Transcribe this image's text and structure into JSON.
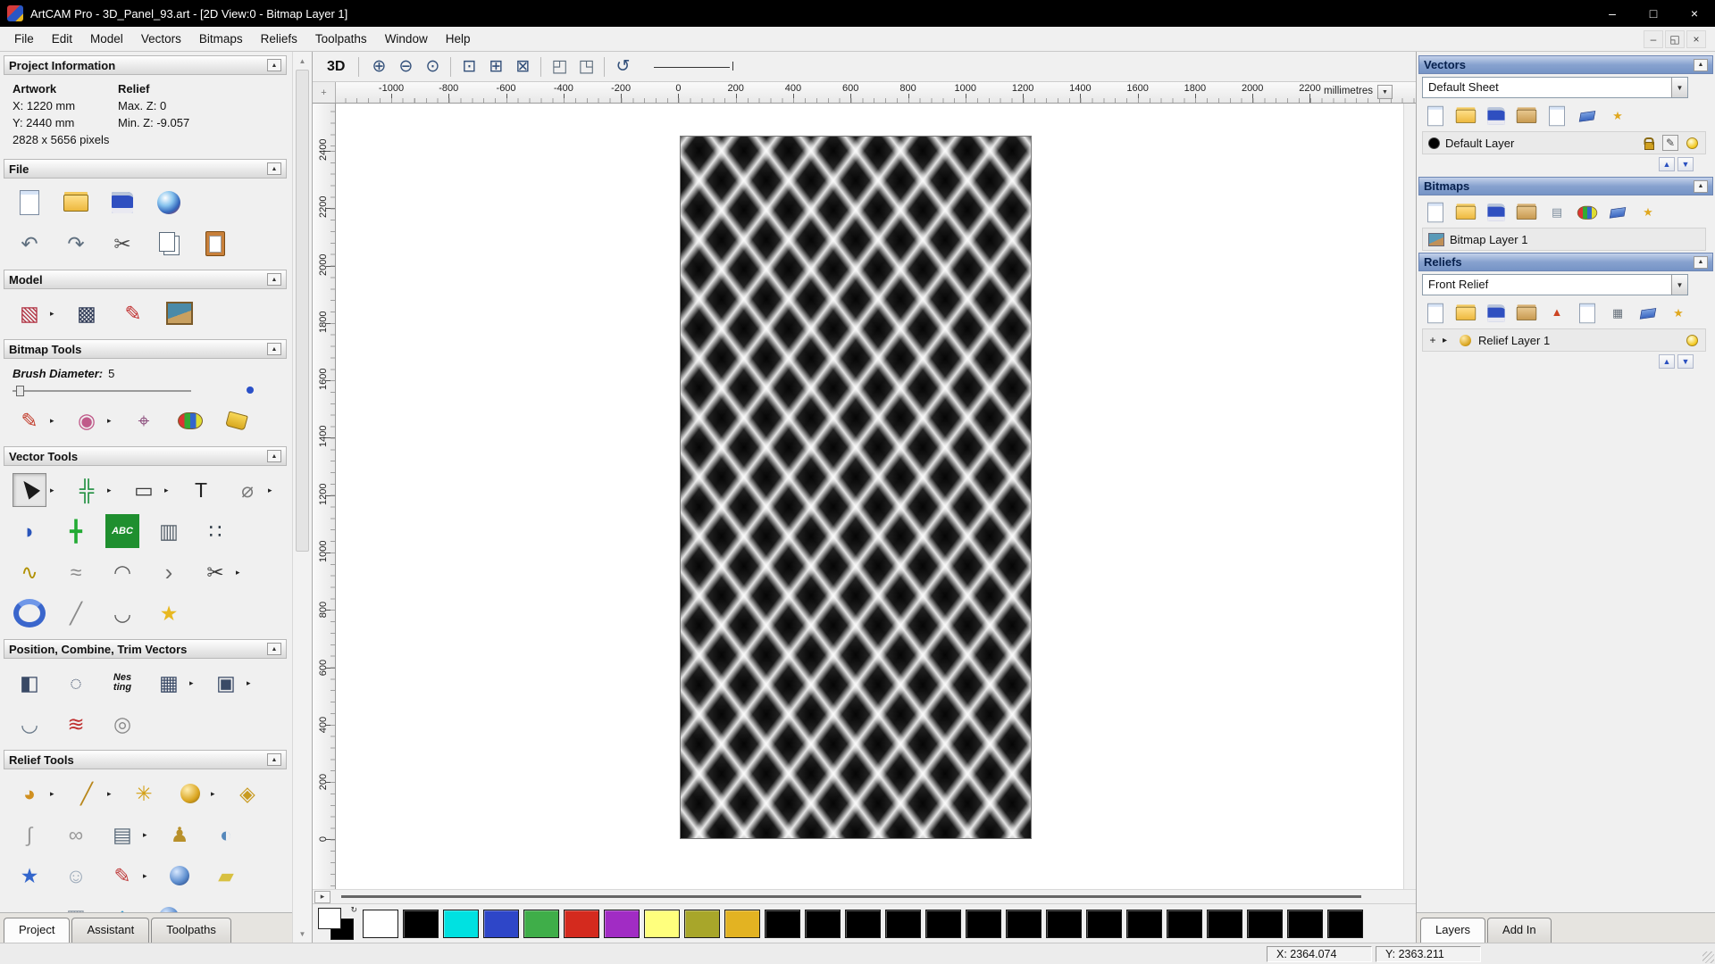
{
  "title_bar": {
    "title": "ArtCAM Pro - 3D_Panel_93.art - [2D View:0 - Bitmap Layer 1]",
    "minimize_glyph": "–",
    "maximize_glyph": "□",
    "close_glyph": "×"
  },
  "menu_bar": {
    "items": [
      "File",
      "Edit",
      "Model",
      "Vectors",
      "Bitmaps",
      "Reliefs",
      "Toolpaths",
      "Window",
      "Help"
    ],
    "mdi_minimize_glyph": "–",
    "mdi_restore_glyph": "◱",
    "mdi_close_glyph": "×"
  },
  "left_panel": {
    "project_information": {
      "title": "Project Information",
      "artwork_header": "Artwork",
      "relief_header": "Relief",
      "x_value": "X: 1220 mm",
      "y_value": "Y: 2440 mm",
      "max_z": "Max. Z: 0",
      "min_z": "Min. Z: -9.057",
      "pixels": "2828 x 5656 pixels"
    },
    "file_title": "File",
    "model_title": "Model",
    "bitmap_tools_title": "Bitmap Tools",
    "brush_diameter_label": "Brush Diameter:",
    "brush_diameter_value": "5",
    "vector_tools_title": "Vector Tools",
    "position_title": "Position, Combine, Trim Vectors",
    "relief_tools_title": "Relief Tools",
    "tabs": [
      "Project",
      "Assistant",
      "Toolpaths"
    ],
    "active_tab": "Project"
  },
  "icon_rows": {
    "file": [
      [
        {
          "name": "new-model-icon",
          "shape": "page"
        },
        {
          "name": "open-model-icon",
          "shape": "folder"
        },
        {
          "name": "save-model-icon",
          "shape": "disk"
        },
        {
          "name": "export-3d-preview-icon",
          "shape": "sphere"
        }
      ],
      [
        {
          "name": "undo-icon",
          "glyph": "↶",
          "color": "#5f6f7f"
        },
        {
          "name": "redo-icon",
          "glyph": "↷",
          "color": "#5f6f7f"
        },
        {
          "name": "cut-icon",
          "glyph": "✂",
          "color": "#4a4a4a"
        },
        {
          "name": "copy-icon",
          "shape": "pages"
        },
        {
          "name": "paste-icon",
          "shape": "clipboard"
        }
      ]
    ],
    "model": [
      [
        {
          "name": "set-model-size-icon",
          "glyph": "▧",
          "color": "#b03040",
          "arrow": true
        },
        {
          "name": "adjust-model-icon",
          "glyph": "▩",
          "color": "#2f3a56"
        },
        {
          "name": "model-lighting-icon",
          "glyph": "✎",
          "color": "#c03030"
        },
        {
          "name": "load-reference-image-icon",
          "shape": "picture"
        }
      ]
    ],
    "bitmap_tools": [
      [
        {
          "name": "paint-brush-icon",
          "glyph": "✎",
          "color": "#c23b2a",
          "arrow": true
        },
        {
          "name": "paint-blocks-icon",
          "glyph": "◉",
          "color": "#c05a8a",
          "arrow": true
        },
        {
          "name": "pick-colour-icon",
          "glyph": "⌖",
          "color": "#8a4a7a"
        },
        {
          "name": "colour-palette-icon",
          "shape": "palette"
        },
        {
          "name": "flood-fill-icon",
          "shape": "bucket"
        }
      ]
    ],
    "vector_tools": [
      [
        {
          "name": "select-vectors-icon",
          "shape": "cursor",
          "selected": true,
          "arrow": true
        },
        {
          "name": "transform-vectors-icon",
          "glyph": "╬",
          "color": "#1f8f3f",
          "arrow": true
        },
        {
          "name": "create-rectangle-icon",
          "glyph": "▭",
          "color": "#3a3a3a",
          "arrow": true
        },
        {
          "name": "create-text-icon",
          "glyph": "T",
          "color": "#222222"
        },
        {
          "name": "measure-tool-icon",
          "glyph": "⌀",
          "color": "#7a7a7a",
          "arrow": true
        }
      ],
      [
        {
          "name": "vector-doctor-icon",
          "glyph": "◗",
          "color": "#2a55bb"
        },
        {
          "name": "block-copy-icon",
          "glyph": "╋",
          "color": "#22aa33"
        },
        {
          "name": "create-text-table-icon",
          "lines": [
            "ABC"
          ],
          "bg": "#1f8f2f",
          "color": "#ffffff"
        },
        {
          "name": "paste-along-curve-icon",
          "glyph": "▥",
          "color": "#55606a"
        },
        {
          "name": "node-editing-icon",
          "glyph": "∷",
          "color": "#333f4a"
        }
      ],
      [
        {
          "name": "create-polyline-icon",
          "glyph": "∿",
          "color": "#b09000"
        },
        {
          "name": "free-polyline-icon",
          "glyph": "≈",
          "color": "#8a8a8a"
        },
        {
          "name": "create-arc-icon",
          "glyph": "◠",
          "color": "#5a5a5a"
        },
        {
          "name": "offset-vector-icon",
          "glyph": "›",
          "color": "#6a6a6a",
          "size": 26
        },
        {
          "name": "trim-vector-icon",
          "glyph": "✂",
          "color": "#3a3a3a",
          "arrow": true
        }
      ],
      [
        {
          "name": "create-ring-icon",
          "shape": "donut"
        },
        {
          "name": "freehand-draw-icon",
          "glyph": "╱",
          "color": "#8a8a8a"
        },
        {
          "name": "arc-fit-icon",
          "glyph": "◡",
          "color": "#5a5a5a"
        },
        {
          "name": "vector-wizard-icon",
          "glyph": "★",
          "color": "#e8b820"
        }
      ]
    ],
    "position_combine": [
      [
        {
          "name": "align-objects-icon",
          "glyph": "◧",
          "color": "#3a4a66"
        },
        {
          "name": "circular-copy-icon",
          "glyph": "◌",
          "color": "#3a4a66"
        },
        {
          "name": "nesting-icon",
          "lines": [
            "Nes",
            "ting"
          ],
          "color": "#111111"
        },
        {
          "name": "align-blocks-icon",
          "glyph": "▦",
          "color": "#3a4a66",
          "arrow": true
        },
        {
          "name": "group-vectors-icon",
          "glyph": "▣",
          "color": "#3a4a66",
          "arrow": true
        }
      ],
      [
        {
          "name": "join-vectors-icon",
          "glyph": "◡",
          "color": "#6a7a8a"
        },
        {
          "name": "weave-vectors-icon",
          "glyph": "≋",
          "color": "#c03030"
        },
        {
          "name": "create-spiral-icon",
          "glyph": "◎",
          "color": "#8a8a8a"
        }
      ]
    ],
    "relief_tools": [
      [
        {
          "name": "shape-editor-icon",
          "glyph": "◕",
          "color": "#d09020",
          "arrow": true
        },
        {
          "name": "sculpting-tool-icon",
          "glyph": "╱",
          "color": "#b8861a",
          "arrow": true
        },
        {
          "name": "smooth-relief-icon",
          "glyph": "✳",
          "color": "#d4a017"
        },
        {
          "name": "dome-tool-icon",
          "shape": "gold-knob",
          "arrow": true
        },
        {
          "name": "angled-plane-icon",
          "glyph": "◈",
          "color": "#c89a20"
        }
      ],
      [
        {
          "name": "smooth-curve-icon",
          "glyph": "∫",
          "color": "#9a9a9a"
        },
        {
          "name": "celtic-knot-icon",
          "glyph": "∞",
          "color": "#9a9a9a"
        },
        {
          "name": "relief-layers-icon",
          "glyph": "▤",
          "color": "#5a6a7a",
          "arrow": true
        },
        {
          "name": "interactive-sculpt-icon",
          "glyph": "♟",
          "color": "#b8902a"
        },
        {
          "name": "constrain-sculpt-icon",
          "glyph": "◐",
          "color": "#5588bb"
        }
      ],
      [
        {
          "name": "star-shape-icon",
          "glyph": "★",
          "color": "#3366cc"
        },
        {
          "name": "face-wizard-icon",
          "glyph": "☺",
          "color": "#9aa8b8"
        },
        {
          "name": "swept-profile-icon",
          "glyph": "✎",
          "color": "#c04040",
          "arrow": true
        },
        {
          "name": "texture-relief-icon",
          "shape": "blue-sphere"
        },
        {
          "name": "extrude-relief-icon",
          "glyph": "▰",
          "color": "#d8c040"
        }
      ],
      [
        {
          "name": "turn-model-icon",
          "glyph": "●",
          "color": "#cc3333"
        },
        {
          "name": "mesh-relief-icon",
          "glyph": "▦",
          "color": "#8a95a0"
        },
        {
          "name": "drape-relief-icon",
          "glyph": "◆",
          "color": "#3399cc"
        },
        {
          "name": "sphere-relief-icon",
          "shape": "blue-sphere"
        },
        {
          "name": "slice-relief-icon",
          "glyph": "▱",
          "color": "#d0b040"
        }
      ]
    ]
  },
  "canvas_toolbar": {
    "view_3d_label": "3D",
    "icons": [
      [
        {
          "name": "zoom-in-icon",
          "glyph": "⊕",
          "color": "#33507a"
        },
        {
          "name": "zoom-out-icon",
          "glyph": "⊖",
          "color": "#33507a"
        },
        {
          "name": "zoom-100-icon",
          "glyph": "⊙",
          "color": "#33507a"
        },
        {
          "sep": true
        },
        {
          "name": "zoom-box-icon",
          "glyph": "⊡",
          "color": "#33507a"
        },
        {
          "name": "zoom-fit-icon",
          "glyph": "⊞",
          "color": "#33507a"
        },
        {
          "name": "zoom-objects-icon",
          "glyph": "⊠",
          "color": "#33507a"
        },
        {
          "sep": true
        },
        {
          "name": "previous-view-icon",
          "glyph": "◰",
          "color": "#5a6a7a"
        },
        {
          "name": "next-view-icon",
          "glyph": "◳",
          "color": "#5a6a7a"
        },
        {
          "sep": true
        },
        {
          "name": "refresh-view-icon",
          "glyph": "↺",
          "color": "#33507a"
        }
      ]
    ]
  },
  "rulers": {
    "unit_label": "millimetres",
    "h_labels": [
      "-1000",
      "-800",
      "-600",
      "-400",
      "-200",
      "0",
      "200",
      "400",
      "600",
      "800",
      "1000",
      "1200",
      "1400",
      "1600",
      "1800",
      "2000",
      "2200"
    ],
    "v_labels": [
      "2400",
      "2200",
      "2000",
      "1800",
      "1600",
      "1400",
      "1200",
      "1000",
      "800",
      "600",
      "400",
      "200",
      "0"
    ]
  },
  "right_panel": {
    "vectors": {
      "title": "Vectors",
      "sheet_selector": "Default Sheet",
      "layer_name": "Default Layer",
      "layer_colour": "#000000",
      "toolbar": [
        [
          {
            "name": "new-vector-layer-icon",
            "shape": "page"
          },
          {
            "name": "open-vector-file-icon",
            "shape": "folder"
          },
          {
            "name": "save-vector-layer-icon",
            "shape": "disk"
          },
          {
            "name": "import-vectors-icon",
            "shape": "folder-tan"
          },
          {
            "name": "export-vectors-icon",
            "shape": "page"
          },
          {
            "name": "delete-vector-layer-icon",
            "shape": "eraser"
          },
          {
            "name": "vector-layer-options-icon",
            "glyph": "★",
            "color": "#e0a820"
          }
        ]
      ]
    },
    "bitmaps": {
      "title": "Bitmaps",
      "layer_name": "Bitmap Layer 1",
      "toolbar": [
        [
          {
            "name": "new-bitmap-layer-icon",
            "shape": "page"
          },
          {
            "name": "open-bitmap-file-icon",
            "shape": "folder"
          },
          {
            "name": "save-bitmap-layer-icon",
            "shape": "disk"
          },
          {
            "name": "import-bitmap-icon",
            "shape": "folder-tan"
          },
          {
            "name": "merge-bitmap-layers-icon",
            "glyph": "▤",
            "color": "#7a8a9a"
          },
          {
            "name": "bitmap-colour-icon",
            "shape": "palette"
          },
          {
            "name": "delete-bitmap-layer-icon",
            "shape": "eraser"
          },
          {
            "name": "bitmap-layer-options-icon",
            "glyph": "★",
            "color": "#e0a820"
          }
        ]
      ]
    },
    "reliefs": {
      "title": "Reliefs",
      "relief_selector": "Front Relief",
      "layer_name": "Relief Layer 1",
      "toolbar": [
        [
          {
            "name": "new-relief-layer-icon",
            "shape": "page"
          },
          {
            "name": "open-relief-file-icon",
            "shape": "folder"
          },
          {
            "name": "save-relief-layer-icon",
            "shape": "disk"
          },
          {
            "name": "import-relief-icon",
            "shape": "folder-tan"
          },
          {
            "name": "calculate-relief-icon",
            "glyph": "▲",
            "color": "#cc4422"
          },
          {
            "name": "duplicate-relief-layer-icon",
            "shape": "page"
          },
          {
            "name": "relief-grid-icon",
            "glyph": "▦",
            "color": "#66707a"
          },
          {
            "name": "delete-relief-layer-icon",
            "shape": "eraser"
          },
          {
            "name": "relief-layer-options-icon",
            "glyph": "★",
            "color": "#e0a820"
          }
        ]
      ]
    },
    "tabs": [
      "Layers",
      "Add In"
    ],
    "active_tab": "Layers"
  },
  "palette": {
    "colors": [
      "#ffffff",
      "#000000",
      "#00e1e1",
      "#2e46c8",
      "#3fae49",
      "#d42a1e",
      "#a12cc4",
      "#ffff7d",
      "#a8a62a",
      "#e3b322",
      "#000000",
      "#000000",
      "#000000",
      "#000000",
      "#000000",
      "#000000",
      "#000000",
      "#000000",
      "#000000",
      "#000000",
      "#000000",
      "#000000",
      "#000000",
      "#000000",
      "#000000"
    ]
  },
  "status_bar": {
    "x_coord": "X: 2364.074",
    "y_coord": "Y: 2363.211"
  }
}
